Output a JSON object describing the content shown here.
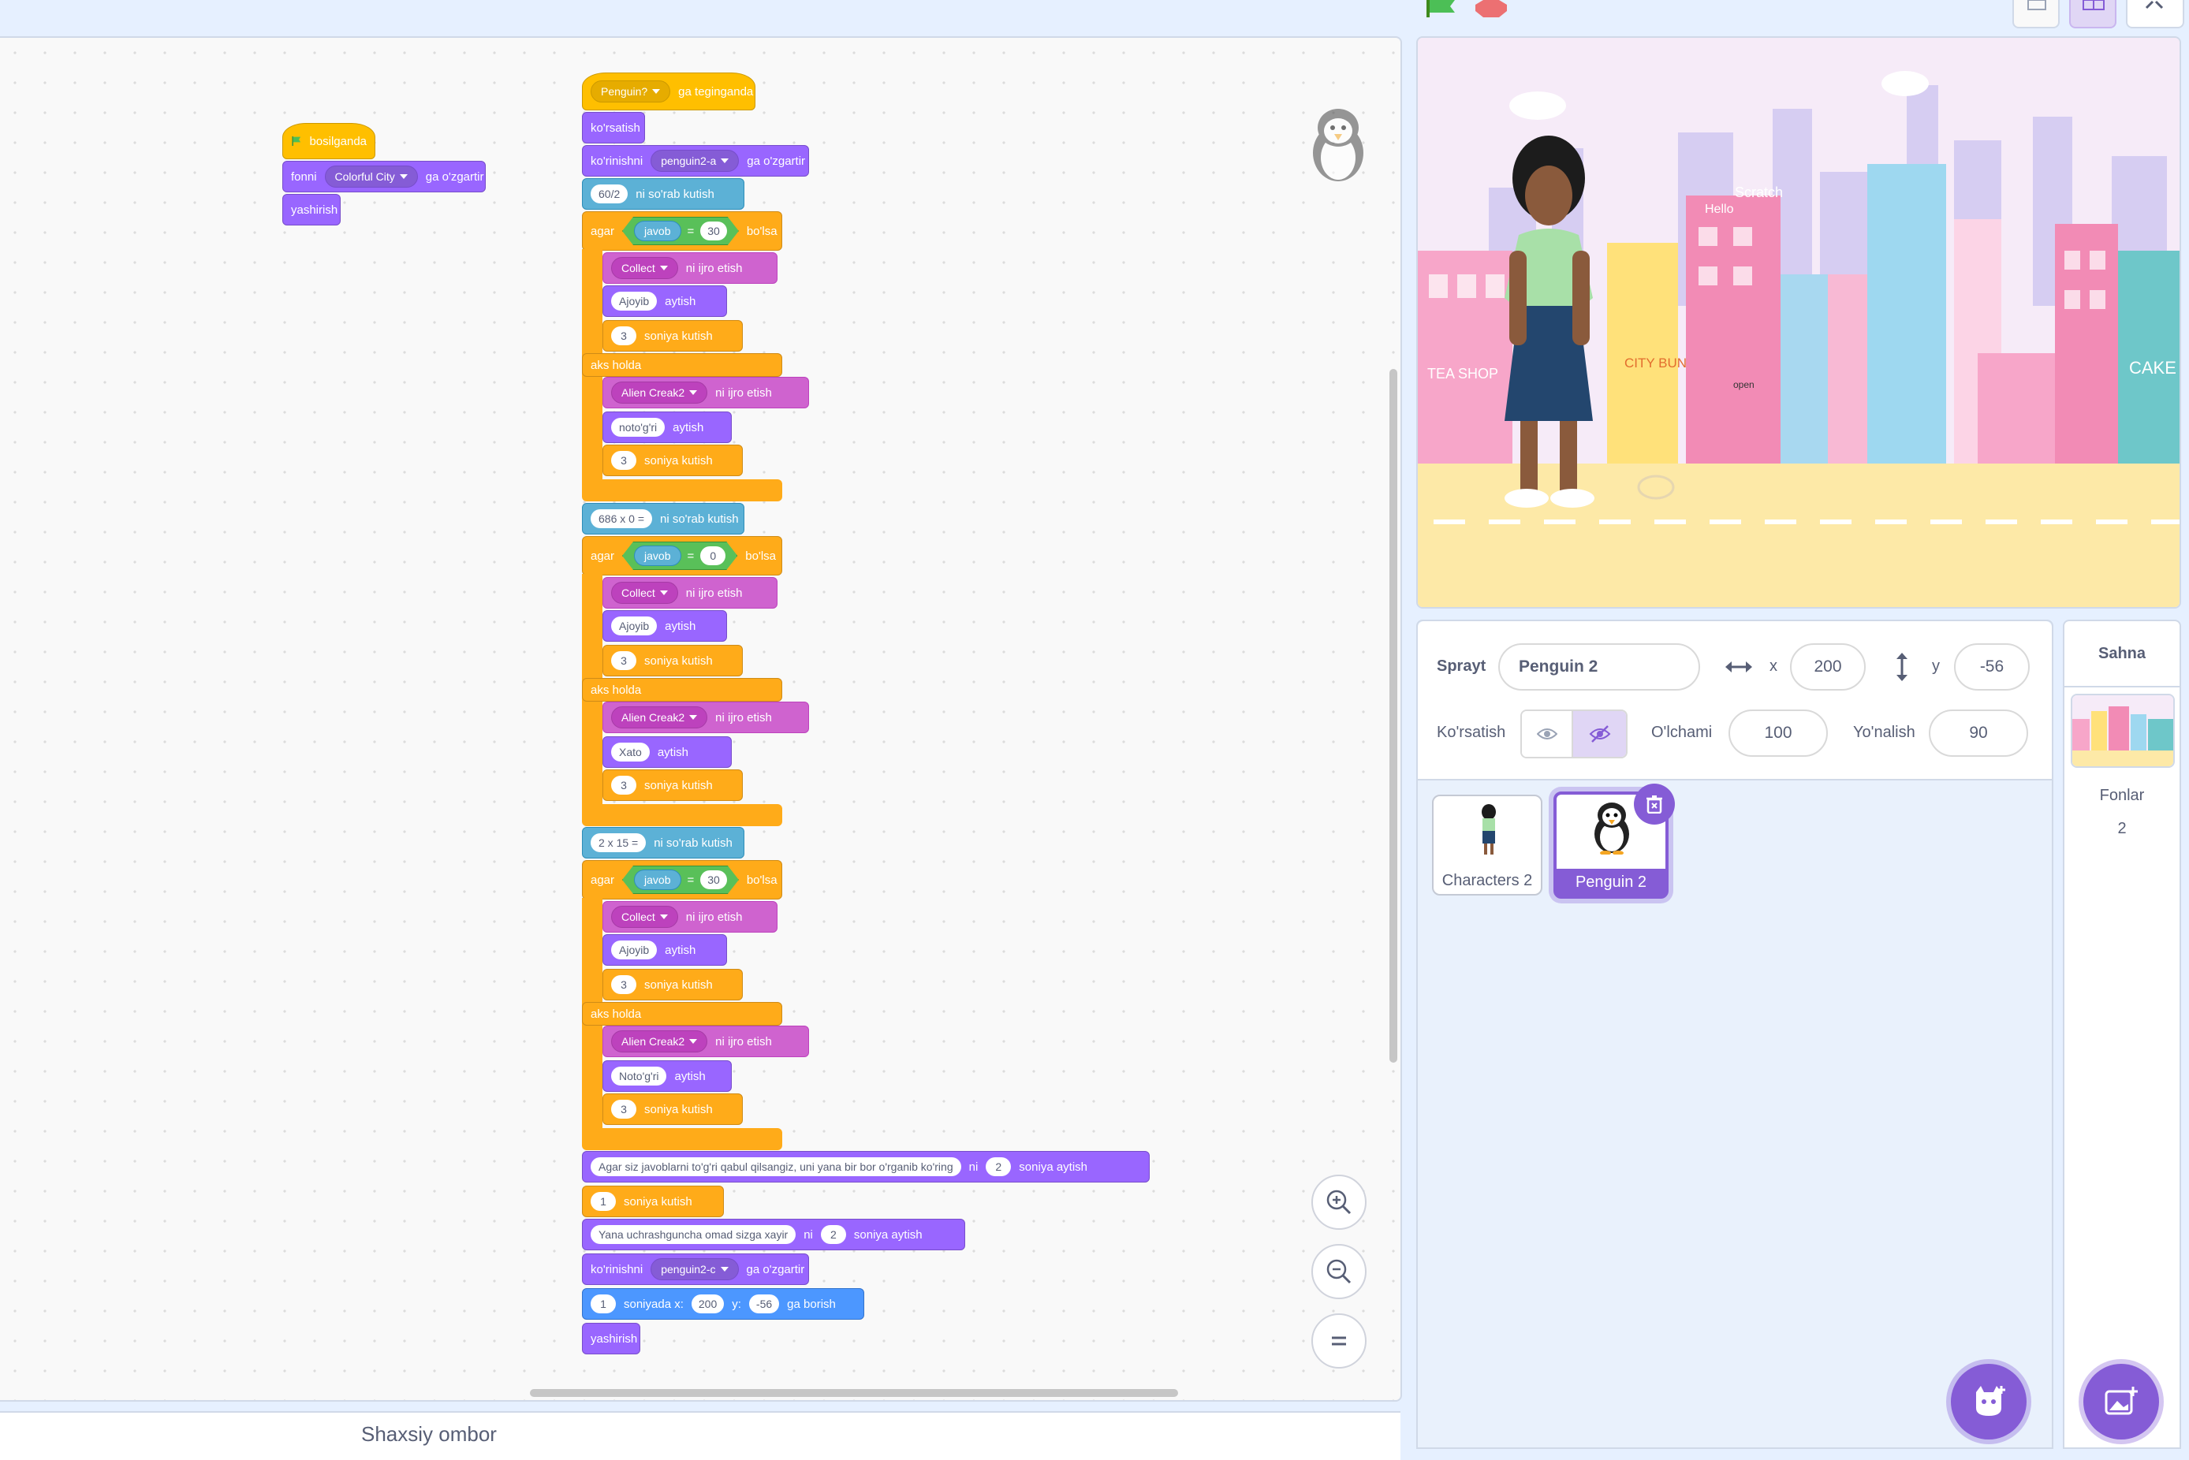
{
  "code": {
    "script1": {
      "hat": "bosilganda",
      "backdrop_prefix": "fonni",
      "backdrop_value": "Colorful City",
      "backdrop_suffix": "ga o'zgartir",
      "hide": "yashirish"
    },
    "script2": {
      "hat_sprite": "Penguin?",
      "hat_suffix": "ga teginganda",
      "show": "ko'rsatish",
      "costume_prefix": "ko'rinishni",
      "costume_value": "penguin2-a",
      "costume_suffix": "ga o'zgartir",
      "ask_suffix": "ni so'rab kutish",
      "if_label": "agar",
      "then_label": "bo'lsa",
      "else_label": "aks holda",
      "answer": "javob",
      "eq": "=",
      "play_suffix": "ni ijro etish",
      "say_suffix": "aytish",
      "wait_suffix": "soniya kutish",
      "sayfor_suffix": "soniya aytish",
      "ni": "ni",
      "sections": [
        {
          "question": "60/2",
          "value": "30",
          "sound_ok": "Collect",
          "ok_text": "Ajoyib",
          "wait_ok": "3",
          "sound_bad": "Alien Creak2",
          "bad_text": "noto'g'ri",
          "wait_bad": "3"
        },
        {
          "question": "686 x 0 =",
          "value": "0",
          "sound_ok": "Collect",
          "ok_text": "Ajoyib",
          "wait_ok": "3",
          "sound_bad": "Alien Creak2",
          "bad_text": "Xato",
          "wait_bad": "3"
        },
        {
          "question": "2 x 15 =",
          "value": "30",
          "sound_ok": "Collect",
          "ok_text": "Ajoyib",
          "wait_ok": "3",
          "sound_bad": "Alien Creak2",
          "bad_text": "Noto'g'ri",
          "wait_bad": "3"
        }
      ],
      "final_say1_text": "Agar siz javoblarni to'g'ri qabul qilsangiz, uni yana bir bor o'rganib ko'ring",
      "final_say1_secs": "2",
      "final_wait": "1",
      "final_say2_text": "Yana uchrashguncha omad sizga xayir",
      "final_say2_secs": "2",
      "costume2_value": "penguin2-c",
      "glide_secs": "1",
      "glide_mid": "soniyada x:",
      "glide_x": "200",
      "glide_ylabel": "y:",
      "glide_y": "-56",
      "glide_suffix": "ga borish",
      "hide": "yashirish"
    }
  },
  "backpack": {
    "label": "Shaxsiy ombor"
  },
  "sprite_info": {
    "sprite_label": "Sprayt",
    "sprite_name": "Penguin 2",
    "x_label": "x",
    "x_value": "200",
    "y_label": "y",
    "y_value": "-56",
    "show_label": "Ko'rsatish",
    "size_label": "O'lchami",
    "size_value": "100",
    "direction_label": "Yo'nalish",
    "direction_value": "90"
  },
  "sprites": [
    {
      "name": "Characters 2",
      "selected": false
    },
    {
      "name": "Penguin 2",
      "selected": true
    }
  ],
  "stage_panel": {
    "title": "Sahna",
    "backdrops_label": "Fonlar",
    "backdrops_count": "2"
  },
  "stage_scene": {
    "sign_tea": "TEA SHOP",
    "sign_scratch": "Scratch",
    "sign_hello": "Hello",
    "sign_city": "CITY BUN",
    "sign_cake": "CAKE",
    "sign_open": "open"
  },
  "colors": {
    "accent": "#855cd6",
    "event": "#ffbf00",
    "looks": "#9966ff",
    "sound": "#cf63cf",
    "control": "#ffab19",
    "sensing": "#5cb1d6",
    "motion": "#4c97ff",
    "operators": "#59c059"
  },
  "icons": [
    "green-flag-icon",
    "stop-icon",
    "zoom-in-icon",
    "zoom-out-icon",
    "zoom-reset-icon",
    "eye-icon",
    "eye-slash-icon",
    "trash-icon",
    "choose-sprite-icon",
    "choose-backdrop-icon",
    "fullscreen-icon"
  ]
}
